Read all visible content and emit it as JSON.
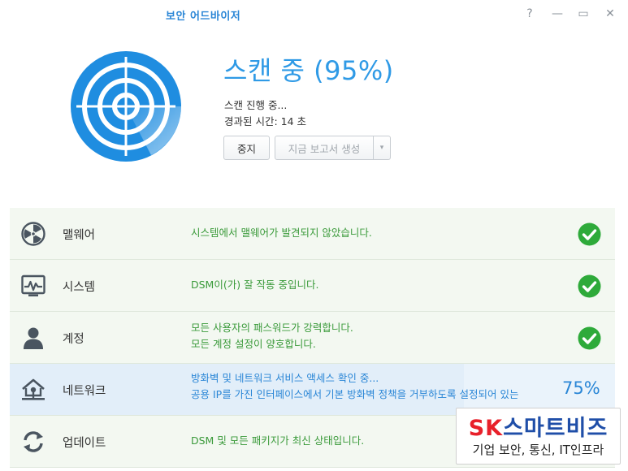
{
  "window": {
    "title": "보안 어드바이저",
    "help_glyph": "?",
    "minimize_glyph": "—",
    "maximize_glyph": "▭",
    "close_glyph": "✕"
  },
  "scan": {
    "heading": "스캔 중 (95%)",
    "progress_percent": 95,
    "status_text": "스캔 진행 중...",
    "elapsed_text": "경과된 시간: 14 초"
  },
  "buttons": {
    "stop": "중지",
    "generate_report": "지금 보고서 생성",
    "dropdown_arrow": "▾"
  },
  "categories": [
    {
      "name": "맬웨어",
      "icon": "radiation-icon",
      "lines": [
        "시스템에서 맬웨어가 발견되지 않았습니다."
      ],
      "state": "ok"
    },
    {
      "name": "시스템",
      "icon": "system-monitor-icon",
      "lines": [
        "DSM이(가) 잘 작동 중입니다."
      ],
      "state": "ok"
    },
    {
      "name": "계정",
      "icon": "user-icon",
      "lines": [
        "모든 사용자의 패스워드가 강력합니다.",
        "모든 계정 설정이 양호합니다."
      ],
      "state": "ok"
    },
    {
      "name": "네트워크",
      "icon": "network-home-icon",
      "lines": [
        "방화벽 및 네트워크 서비스 액세스 확인 중...",
        "공용 IP를 가진 인터페이스에서 기본 방화벽 정책을 거부하도록 설정되어 있는"
      ],
      "state": "scanning",
      "progress_text": "75%",
      "progress_percent": 75
    },
    {
      "name": "업데이트",
      "icon": "update-refresh-icon",
      "lines": [
        "DSM 및 모든 패키지가 최신 상태입니다."
      ],
      "state": "ok"
    }
  ],
  "watermark": {
    "brand_red": "SK",
    "brand_blue": "스마트비즈",
    "tagline": "기업 보안, 통신, IT인프라"
  },
  "colors": {
    "accent_blue": "#2f9ae6",
    "ok_green": "#3a9a3a",
    "check_green": "#2eaa3a",
    "row_ok_bg": "#f3f8f1",
    "row_scan_bg": "#eaf3fb"
  }
}
